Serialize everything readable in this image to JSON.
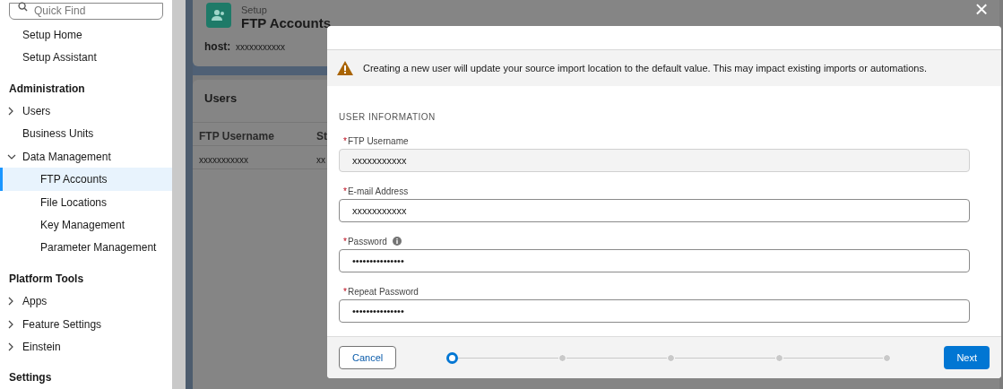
{
  "sidebar": {
    "search": {
      "placeholder": "Quick Find"
    },
    "sections": [
      {
        "items": [
          {
            "label": "Setup Home",
            "selected": false
          },
          {
            "label": "Setup Assistant",
            "selected": false
          }
        ]
      },
      {
        "heading": "Administration",
        "items": [
          {
            "label": "Users",
            "selected": false,
            "expanded": false
          },
          {
            "label": "Business Units",
            "selected": false
          },
          {
            "label": "Data Management",
            "selected": false,
            "expanded": true,
            "children": [
              {
                "label": "FTP Accounts",
                "selected": true
              },
              {
                "label": "File Locations",
                "selected": false
              },
              {
                "label": "Key Management",
                "selected": false
              },
              {
                "label": "Parameter Management",
                "selected": false
              }
            ]
          }
        ]
      },
      {
        "heading": "Platform Tools",
        "items": [
          {
            "label": "Apps",
            "selected": false,
            "expanded": false
          },
          {
            "label": "Feature Settings",
            "selected": false,
            "expanded": false
          },
          {
            "label": "Einstein",
            "selected": false,
            "expanded": false
          }
        ]
      },
      {
        "heading": "Settings"
      }
    ]
  },
  "page": {
    "breadcrumb": "Setup",
    "title": "FTP Accounts",
    "host_label": "host:",
    "host_value": "xxxxxxxxxxx",
    "users_card": {
      "title": "Users",
      "columns": [
        "FTP Username",
        "St"
      ],
      "rows": [
        [
          "xxxxxxxxxxx",
          "xx"
        ]
      ]
    }
  },
  "modal": {
    "close": "×",
    "warning": "Creating a new user will update your source import location to the default value. This may impact existing imports or automations.",
    "section_title": "USER INFORMATION",
    "fields": [
      {
        "label": "FTP Username",
        "required_mark": "*",
        "value": "xxxxxxxxxxx",
        "disabled": true,
        "info": false
      },
      {
        "label": "E-mail Address",
        "required_mark": "*",
        "value": "xxxxxxxxxxx",
        "disabled": false,
        "info": false
      },
      {
        "label": "Password",
        "required_mark": "*",
        "value": "•••••••••••••••",
        "disabled": false,
        "info": true
      },
      {
        "label": "Repeat Password",
        "required_mark": "*",
        "value": "•••••••••••••••",
        "disabled": false,
        "info": false
      }
    ],
    "cancel": "Cancel",
    "next": "Next",
    "steps": [
      {
        "selected": true
      },
      {
        "selected": false
      },
      {
        "selected": false
      },
      {
        "selected": false
      },
      {
        "selected": false
      }
    ]
  }
}
